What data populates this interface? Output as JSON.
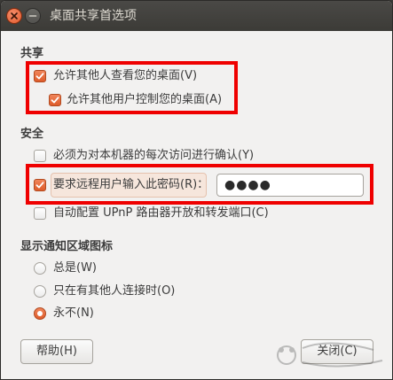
{
  "window": {
    "title": "桌面共享首选项"
  },
  "sharing": {
    "heading": "共享",
    "allow_view": "允许其他人查看您的桌面(V)",
    "allow_control": "允许其他用户控制您的桌面(A)"
  },
  "security": {
    "heading": "安全",
    "confirm_access": "必须为对本机器的每次访问进行确认(Y)",
    "require_password": "要求远程用户输入此密码(R)：",
    "password_value": "●●●●",
    "upnp": "自动配置 UPnP 路由器开放和转发端口(C)"
  },
  "notification": {
    "heading": "显示通知区域图标",
    "always": "总是(W)",
    "only_connected": "只在有其他人连接时(O)",
    "never": "永不(N)"
  },
  "buttons": {
    "help": "帮助(H)",
    "close": "关闭(C)"
  },
  "state": {
    "allow_view_checked": true,
    "allow_control_checked": true,
    "confirm_access_checked": false,
    "require_password_checked": true,
    "upnp_checked": false,
    "selected_notification": "never"
  },
  "colors": {
    "accent": "#de5b2a",
    "highlight_red": "#ef0000",
    "titlebar": "#3c3b37",
    "window_bg": "#f2f1f0"
  },
  "icons": [
    "close-icon",
    "minimize-icon",
    "checkmark-icon"
  ]
}
